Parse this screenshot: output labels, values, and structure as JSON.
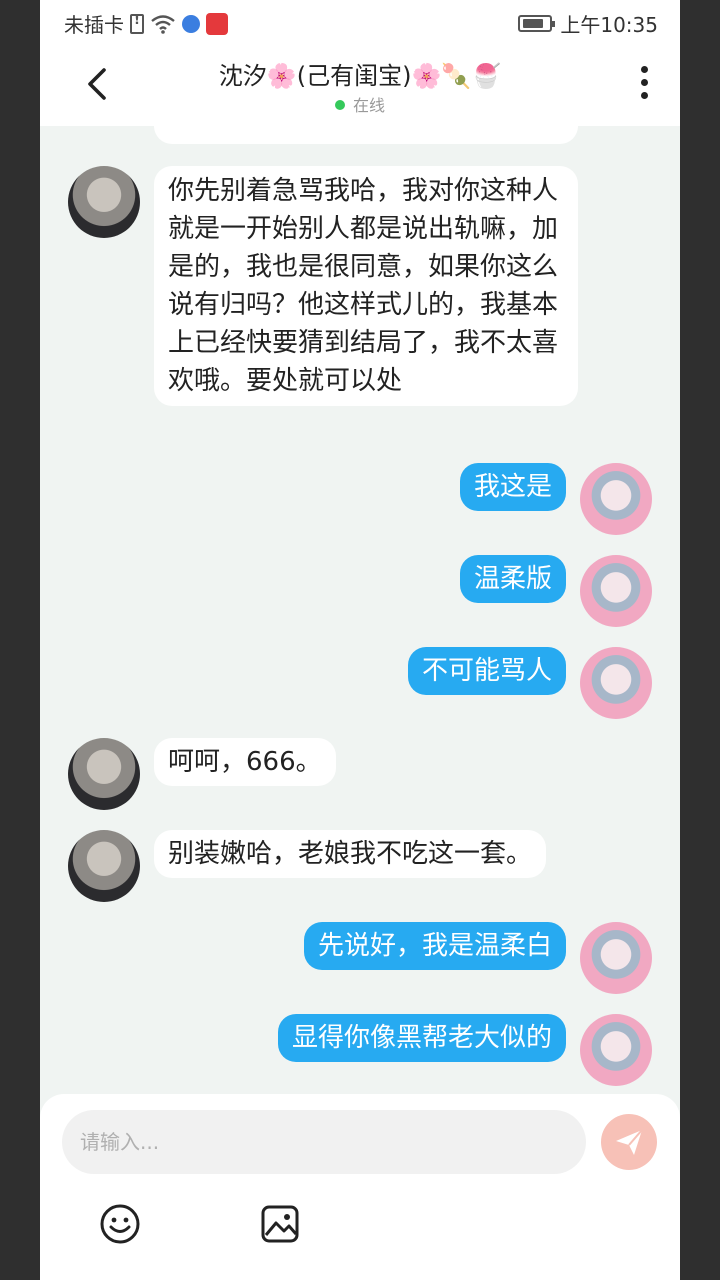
{
  "status_bar": {
    "carrier": "未插卡",
    "time": "上午10:35"
  },
  "header": {
    "title": "沈汐🌸(己有闺宝)🌸🍡🍧",
    "presence": "在线"
  },
  "messages": [
    {
      "from": "them",
      "text": "你先别着急骂我哈，我对你这种人就是一开始别人都是说出轨嘛，加是的，我也是很同意，如果你这么说有归吗？他这样式儿的，我基本上已经快要猜到结局了，我不太喜欢哦。要处就可以处"
    },
    {
      "from": "me",
      "text": "我这是"
    },
    {
      "from": "me",
      "text": "温柔版"
    },
    {
      "from": "me",
      "text": "不可能骂人"
    },
    {
      "from": "them",
      "text": "呵呵，666。"
    },
    {
      "from": "them",
      "text": "别装嫩哈，老娘我不吃这一套。"
    },
    {
      "from": "me",
      "text": "先说好，我是温柔白"
    },
    {
      "from": "me",
      "text": "显得你像黑帮老大似的"
    }
  ],
  "composer": {
    "placeholder": "请输入..."
  },
  "icons": {
    "back": "chevron-left-icon",
    "more": "more-vertical-icon",
    "send": "send-icon",
    "emoji": "emoji-icon",
    "image": "image-icon"
  },
  "colors": {
    "my_bubble": "#27aaf1",
    "their_bubble": "#ffffff",
    "online_dot": "#35c95b",
    "send_button": "#f7c1b7",
    "chat_background": "#f0f4f2"
  }
}
